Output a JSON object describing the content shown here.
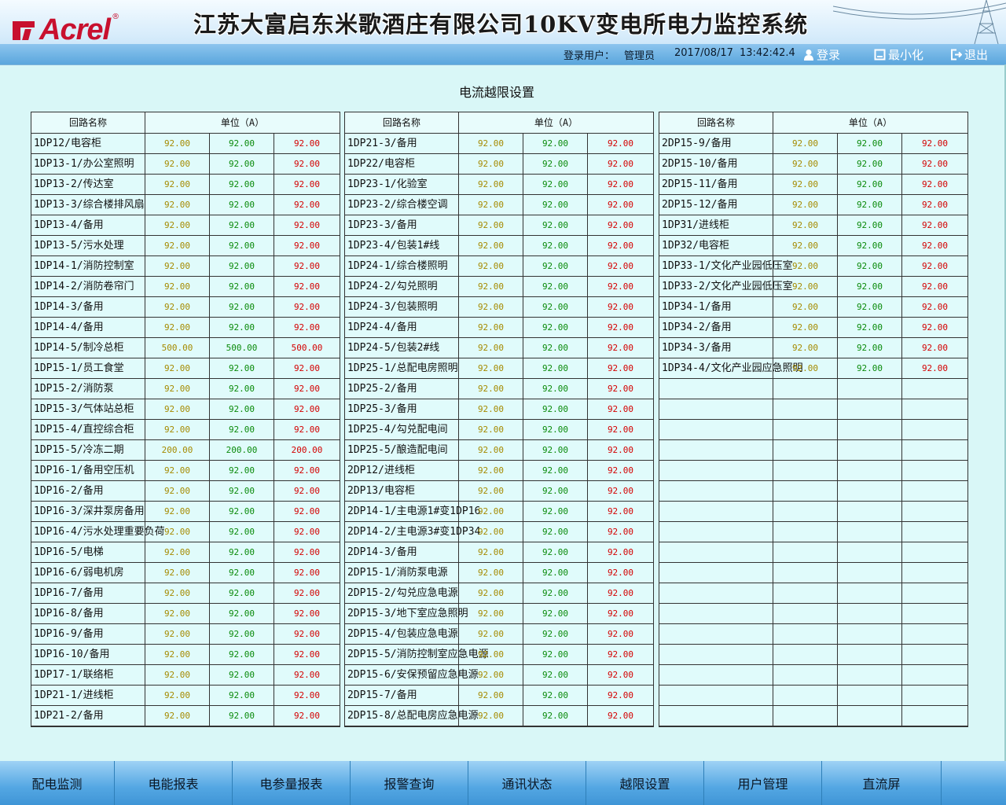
{
  "header": {
    "logo_text": "Acrel",
    "logo_reg": "®",
    "title": "江苏大富启东米歌酒庄有限公司10KV变电所电力监控系统",
    "user_label": "登录用户：",
    "user_name": "管理员",
    "date": "2017/08/17",
    "time": "13:42:42.4",
    "login_label": "登录",
    "minimize_label": "最小化",
    "exit_label": "退出"
  },
  "page_title": "电流越限设置",
  "table_header": {
    "name": "回路名称",
    "unit": "单位（A）"
  },
  "columns": [
    {
      "rows": [
        {
          "name": "1DP12/电容柜",
          "v": [
            "92.00",
            "92.00",
            "92.00"
          ]
        },
        {
          "name": "1DP13-1/办公室照明",
          "v": [
            "92.00",
            "92.00",
            "92.00"
          ]
        },
        {
          "name": "1DP13-2/传达室",
          "v": [
            "92.00",
            "92.00",
            "92.00"
          ]
        },
        {
          "name": "1DP13-3/综合楼排风扇",
          "v": [
            "92.00",
            "92.00",
            "92.00"
          ]
        },
        {
          "name": "1DP13-4/备用",
          "v": [
            "92.00",
            "92.00",
            "92.00"
          ]
        },
        {
          "name": "1DP13-5/污水处理",
          "v": [
            "92.00",
            "92.00",
            "92.00"
          ]
        },
        {
          "name": "1DP14-1/消防控制室",
          "v": [
            "92.00",
            "92.00",
            "92.00"
          ]
        },
        {
          "name": "1DP14-2/消防卷帘门",
          "v": [
            "92.00",
            "92.00",
            "92.00"
          ]
        },
        {
          "name": "1DP14-3/备用",
          "v": [
            "92.00",
            "92.00",
            "92.00"
          ]
        },
        {
          "name": "1DP14-4/备用",
          "v": [
            "92.00",
            "92.00",
            "92.00"
          ]
        },
        {
          "name": "1DP14-5/制冷总柜",
          "v": [
            "500.00",
            "500.00",
            "500.00"
          ]
        },
        {
          "name": "1DP15-1/员工食堂",
          "v": [
            "92.00",
            "92.00",
            "92.00"
          ]
        },
        {
          "name": "1DP15-2/消防泵",
          "v": [
            "92.00",
            "92.00",
            "92.00"
          ]
        },
        {
          "name": "1DP15-3/气体站总柜",
          "v": [
            "92.00",
            "92.00",
            "92.00"
          ]
        },
        {
          "name": "1DP15-4/直控综合柜",
          "v": [
            "92.00",
            "92.00",
            "92.00"
          ]
        },
        {
          "name": "1DP15-5/冷冻二期",
          "v": [
            "200.00",
            "200.00",
            "200.00"
          ]
        },
        {
          "name": "1DP16-1/备用空压机",
          "v": [
            "92.00",
            "92.00",
            "92.00"
          ]
        },
        {
          "name": "1DP16-2/备用",
          "v": [
            "92.00",
            "92.00",
            "92.00"
          ]
        },
        {
          "name": "1DP16-3/深井泵房备用",
          "v": [
            "92.00",
            "92.00",
            "92.00"
          ]
        },
        {
          "name": "1DP16-4/污水处理重要负荷",
          "v": [
            "92.00",
            "92.00",
            "92.00"
          ]
        },
        {
          "name": "1DP16-5/电梯",
          "v": [
            "92.00",
            "92.00",
            "92.00"
          ]
        },
        {
          "name": "1DP16-6/弱电机房",
          "v": [
            "92.00",
            "92.00",
            "92.00"
          ]
        },
        {
          "name": "1DP16-7/备用",
          "v": [
            "92.00",
            "92.00",
            "92.00"
          ]
        },
        {
          "name": "1DP16-8/备用",
          "v": [
            "92.00",
            "92.00",
            "92.00"
          ]
        },
        {
          "name": "1DP16-9/备用",
          "v": [
            "92.00",
            "92.00",
            "92.00"
          ]
        },
        {
          "name": "1DP16-10/备用",
          "v": [
            "92.00",
            "92.00",
            "92.00"
          ]
        },
        {
          "name": "1DP17-1/联络柜",
          "v": [
            "92.00",
            "92.00",
            "92.00"
          ]
        },
        {
          "name": "1DP21-1/进线柜",
          "v": [
            "92.00",
            "92.00",
            "92.00"
          ]
        },
        {
          "name": "1DP21-2/备用",
          "v": [
            "92.00",
            "92.00",
            "92.00"
          ]
        }
      ]
    },
    {
      "rows": [
        {
          "name": "1DP21-3/备用",
          "v": [
            "92.00",
            "92.00",
            "92.00"
          ]
        },
        {
          "name": "1DP22/电容柜",
          "v": [
            "92.00",
            "92.00",
            "92.00"
          ]
        },
        {
          "name": "1DP23-1/化验室",
          "v": [
            "92.00",
            "92.00",
            "92.00"
          ]
        },
        {
          "name": "1DP23-2/综合楼空调",
          "v": [
            "92.00",
            "92.00",
            "92.00"
          ]
        },
        {
          "name": "1DP23-3/备用",
          "v": [
            "92.00",
            "92.00",
            "92.00"
          ]
        },
        {
          "name": "1DP23-4/包装1#线",
          "v": [
            "92.00",
            "92.00",
            "92.00"
          ]
        },
        {
          "name": "1DP24-1/综合楼照明",
          "v": [
            "92.00",
            "92.00",
            "92.00"
          ]
        },
        {
          "name": "1DP24-2/勾兑照明",
          "v": [
            "92.00",
            "92.00",
            "92.00"
          ]
        },
        {
          "name": "1DP24-3/包装照明",
          "v": [
            "92.00",
            "92.00",
            "92.00"
          ]
        },
        {
          "name": "1DP24-4/备用",
          "v": [
            "92.00",
            "92.00",
            "92.00"
          ]
        },
        {
          "name": "1DP24-5/包装2#线",
          "v": [
            "92.00",
            "92.00",
            "92.00"
          ]
        },
        {
          "name": "1DP25-1/总配电房照明",
          "v": [
            "92.00",
            "92.00",
            "92.00"
          ]
        },
        {
          "name": "1DP25-2/备用",
          "v": [
            "92.00",
            "92.00",
            "92.00"
          ]
        },
        {
          "name": "1DP25-3/备用",
          "v": [
            "92.00",
            "92.00",
            "92.00"
          ]
        },
        {
          "name": "1DP25-4/勾兑配电间",
          "v": [
            "92.00",
            "92.00",
            "92.00"
          ]
        },
        {
          "name": "1DP25-5/酿造配电间",
          "v": [
            "92.00",
            "92.00",
            "92.00"
          ]
        },
        {
          "name": "2DP12/进线柜",
          "v": [
            "92.00",
            "92.00",
            "92.00"
          ]
        },
        {
          "name": "2DP13/电容柜",
          "v": [
            "92.00",
            "92.00",
            "92.00"
          ]
        },
        {
          "name": "2DP14-1/主电源1#变1DP16",
          "v": [
            "92.00",
            "92.00",
            "92.00"
          ]
        },
        {
          "name": "2DP14-2/主电源3#变1DP34",
          "v": [
            "92.00",
            "92.00",
            "92.00"
          ]
        },
        {
          "name": "2DP14-3/备用",
          "v": [
            "92.00",
            "92.00",
            "92.00"
          ]
        },
        {
          "name": "2DP15-1/消防泵电源",
          "v": [
            "92.00",
            "92.00",
            "92.00"
          ]
        },
        {
          "name": "2DP15-2/勾兑应急电源",
          "v": [
            "92.00",
            "92.00",
            "92.00"
          ]
        },
        {
          "name": "2DP15-3/地下室应急照明",
          "v": [
            "92.00",
            "92.00",
            "92.00"
          ]
        },
        {
          "name": "2DP15-4/包装应急电源",
          "v": [
            "92.00",
            "92.00",
            "92.00"
          ]
        },
        {
          "name": "2DP15-5/消防控制室应急电源",
          "v": [
            "92.00",
            "92.00",
            "92.00"
          ]
        },
        {
          "name": "2DP15-6/安保预留应急电源",
          "v": [
            "92.00",
            "92.00",
            "92.00"
          ]
        },
        {
          "name": "2DP15-7/备用",
          "v": [
            "92.00",
            "92.00",
            "92.00"
          ]
        },
        {
          "name": "2DP15-8/总配电房应急电源",
          "v": [
            "92.00",
            "92.00",
            "92.00"
          ]
        }
      ]
    },
    {
      "rows": [
        {
          "name": "2DP15-9/备用",
          "v": [
            "92.00",
            "92.00",
            "92.00"
          ]
        },
        {
          "name": "2DP15-10/备用",
          "v": [
            "92.00",
            "92.00",
            "92.00"
          ]
        },
        {
          "name": "2DP15-11/备用",
          "v": [
            "92.00",
            "92.00",
            "92.00"
          ]
        },
        {
          "name": "2DP15-12/备用",
          "v": [
            "92.00",
            "92.00",
            "92.00"
          ]
        },
        {
          "name": "1DP31/进线柜",
          "v": [
            "92.00",
            "92.00",
            "92.00"
          ]
        },
        {
          "name": "1DP32/电容柜",
          "v": [
            "92.00",
            "92.00",
            "92.00"
          ]
        },
        {
          "name": "1DP33-1/文化产业园低压室",
          "v": [
            "92.00",
            "92.00",
            "92.00"
          ]
        },
        {
          "name": "1DP33-2/文化产业园低压室",
          "v": [
            "92.00",
            "92.00",
            "92.00"
          ]
        },
        {
          "name": "1DP34-1/备用",
          "v": [
            "92.00",
            "92.00",
            "92.00"
          ]
        },
        {
          "name": "1DP34-2/备用",
          "v": [
            "92.00",
            "92.00",
            "92.00"
          ]
        },
        {
          "name": "1DP34-3/备用",
          "v": [
            "92.00",
            "92.00",
            "92.00"
          ]
        },
        {
          "name": "1DP34-4/文化产业园应急照明",
          "v": [
            "92.00",
            "92.00",
            "92.00"
          ]
        },
        {
          "name": "",
          "v": [
            "",
            "",
            ""
          ]
        },
        {
          "name": "",
          "v": [
            "",
            "",
            ""
          ]
        },
        {
          "name": "",
          "v": [
            "",
            "",
            ""
          ]
        },
        {
          "name": "",
          "v": [
            "",
            "",
            ""
          ]
        },
        {
          "name": "",
          "v": [
            "",
            "",
            ""
          ]
        },
        {
          "name": "",
          "v": [
            "",
            "",
            ""
          ]
        },
        {
          "name": "",
          "v": [
            "",
            "",
            ""
          ]
        },
        {
          "name": "",
          "v": [
            "",
            "",
            ""
          ]
        },
        {
          "name": "",
          "v": [
            "",
            "",
            ""
          ]
        },
        {
          "name": "",
          "v": [
            "",
            "",
            ""
          ]
        },
        {
          "name": "",
          "v": [
            "",
            "",
            ""
          ]
        },
        {
          "name": "",
          "v": [
            "",
            "",
            ""
          ]
        },
        {
          "name": "",
          "v": [
            "",
            "",
            ""
          ]
        },
        {
          "name": "",
          "v": [
            "",
            "",
            ""
          ]
        },
        {
          "name": "",
          "v": [
            "",
            "",
            ""
          ]
        },
        {
          "name": "",
          "v": [
            "",
            "",
            ""
          ]
        },
        {
          "name": "",
          "v": [
            "",
            "",
            ""
          ]
        }
      ]
    }
  ],
  "nav": [
    {
      "label": "配电监测"
    },
    {
      "label": "电能报表"
    },
    {
      "label": "电参量报表"
    },
    {
      "label": "报警查询"
    },
    {
      "label": "通讯状态"
    },
    {
      "label": "越限设置"
    },
    {
      "label": "用户管理"
    },
    {
      "label": "直流屏"
    },
    {
      "label": ""
    }
  ]
}
